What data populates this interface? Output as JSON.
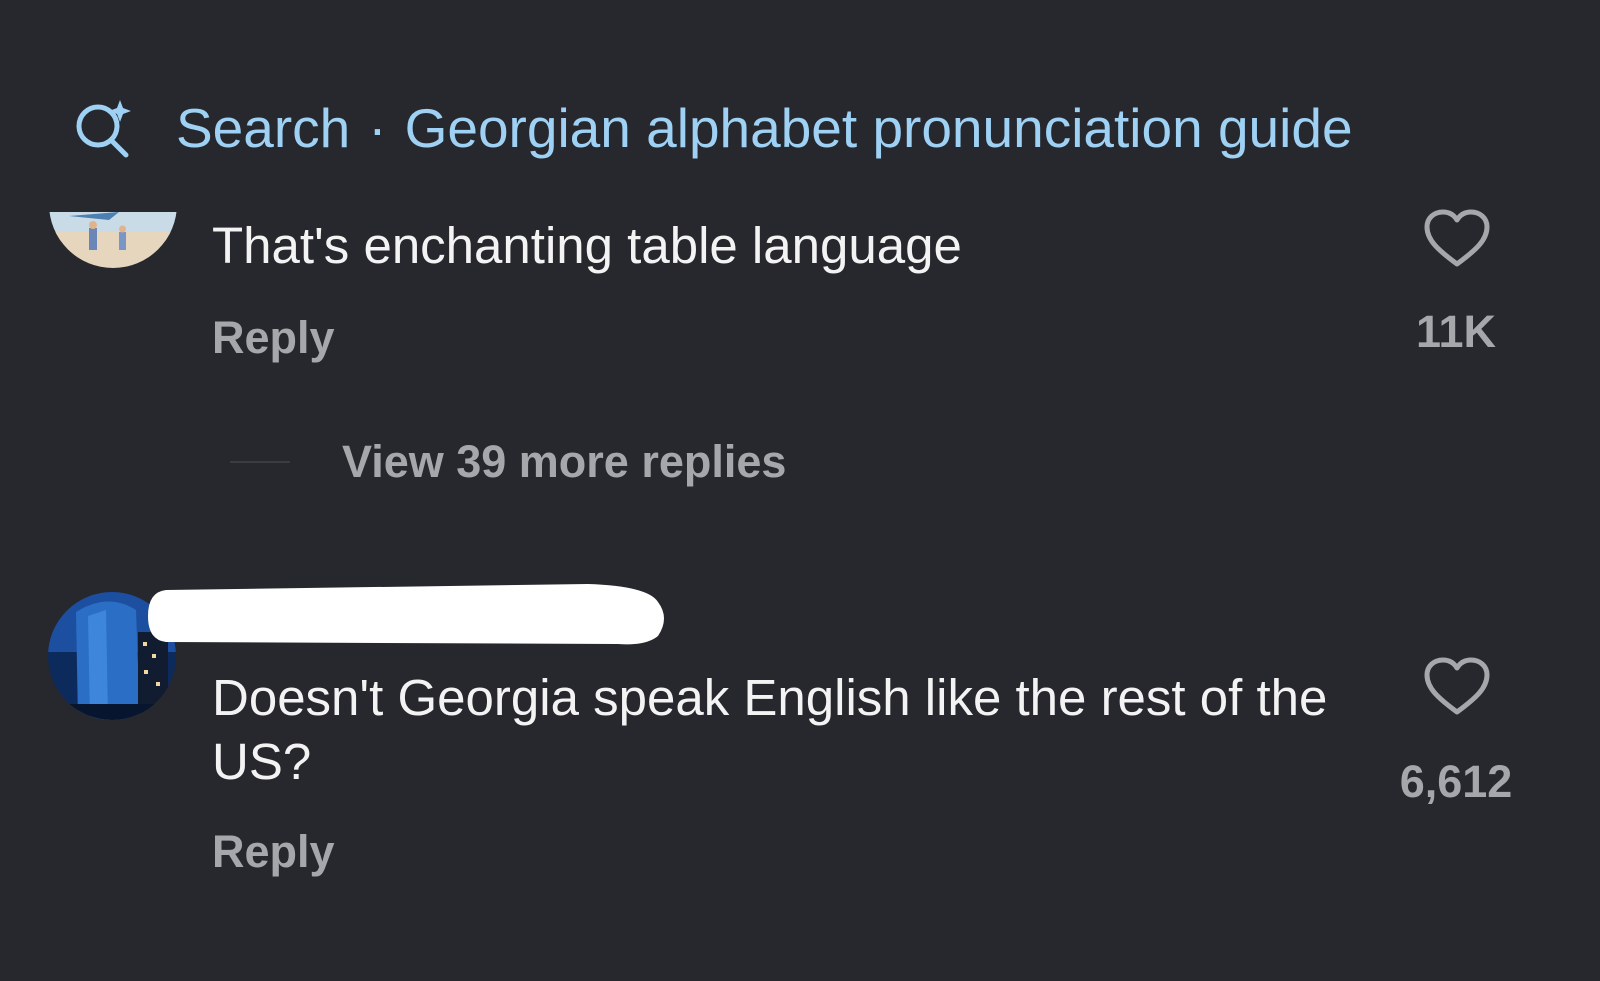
{
  "search": {
    "label": "Search",
    "separator": "·",
    "query": "Georgian alphabet pronunciation guide",
    "icon": "search-sparkle-icon"
  },
  "comments": [
    {
      "text": "That's enchanting table language",
      "reply_label": "Reply",
      "like_count": "11K",
      "like_icon": "heart-icon",
      "avatar": "beach-photo-avatar"
    },
    {
      "text": "Doesn't Georgia speak English like the rest of the US?",
      "reply_label": "Reply",
      "like_count": "6,612",
      "like_icon": "heart-icon",
      "avatar": "city-building-avatar"
    }
  ],
  "view_replies": {
    "label": "View 39 more replies"
  },
  "colors": {
    "background": "#26282e",
    "accent": "#9ed1f4",
    "text_primary": "#f3f3f4",
    "text_secondary": "#a6a7ab"
  }
}
